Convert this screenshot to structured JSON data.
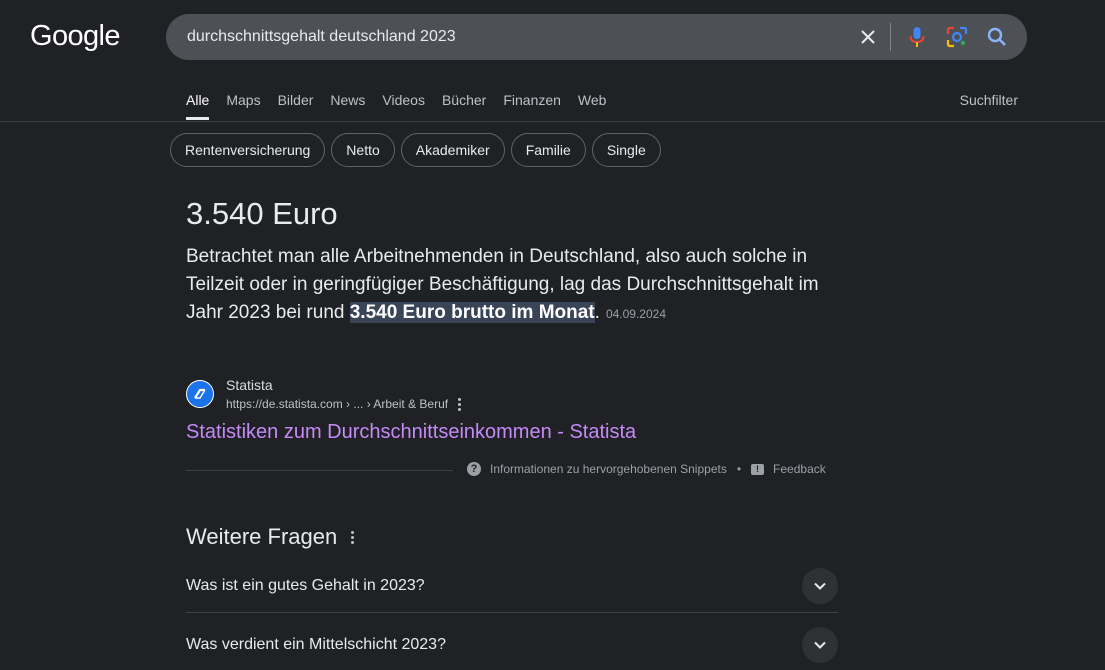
{
  "logo": "Google",
  "search": {
    "query": "durchschnittsgehalt deutschland 2023"
  },
  "tabs": [
    "Alle",
    "Maps",
    "Bilder",
    "News",
    "Videos",
    "Bücher",
    "Finanzen",
    "Web"
  ],
  "suchfilter": "Suchfilter",
  "chips": [
    "Rentenversicherung",
    "Netto",
    "Akademiker",
    "Familie",
    "Single"
  ],
  "featured": {
    "title": "3.540 Euro",
    "snippet_before": "Betrachtet man alle Arbeitnehmenden in Deutschland, also auch solche in Teilzeit oder in geringfügiger Beschäftigung, lag das Durchschnittsgehalt im Jahr 2023 bei rund ",
    "snippet_highlight": "3.540 Euro brutto im Monat",
    "snippet_after": ".",
    "date": "04.09.2024",
    "source_name": "Statista",
    "source_url": "https://de.statista.com › ... › Arbeit & Beruf",
    "link_text": "Statistiken zum Durchschnittseinkommen - Statista",
    "info_text": "Informationen zu hervorgehobenen Snippets",
    "bullet": "•",
    "feedback": "Feedback"
  },
  "weitere_fragen": {
    "title": "Weitere Fragen",
    "questions": [
      "Was ist ein gutes Gehalt in 2023?",
      "Was verdient ein Mittelschicht 2023?"
    ]
  },
  "colors": {
    "background": "#202124",
    "link": "#c58af9",
    "highlight": "#394457"
  }
}
